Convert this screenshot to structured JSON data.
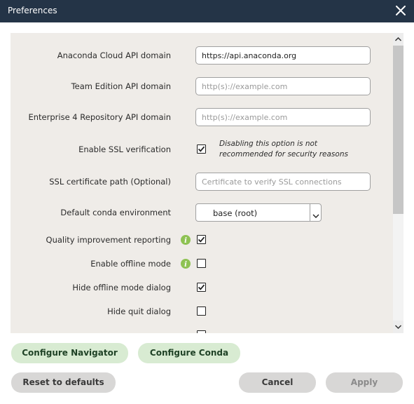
{
  "window": {
    "title": "Preferences",
    "close_icon": "close-icon"
  },
  "fields": {
    "cloud_api": {
      "label": "Anaconda Cloud API domain",
      "value": "https://api.anaconda.org",
      "placeholder": ""
    },
    "team_api": {
      "label": "Team Edition API domain",
      "value": "",
      "placeholder": "http(s)://example.com"
    },
    "enterprise_api": {
      "label": "Enterprise 4 Repository API domain",
      "value": "",
      "placeholder": "http(s)://example.com"
    },
    "ssl_verify": {
      "label": "Enable SSL verification",
      "checked": true,
      "note": "Disabling this option is not recommended for security reasons"
    },
    "ssl_cert": {
      "label": "SSL certificate path (Optional)",
      "value": "",
      "placeholder": "Certificate to verify SSL connections"
    },
    "conda_env": {
      "label": "Default conda environment",
      "value": "base (root)"
    },
    "quality": {
      "label": "Quality improvement reporting",
      "checked": true
    },
    "offline": {
      "label": "Enable offline mode",
      "checked": false
    },
    "hide_offline": {
      "label": "Hide offline mode dialog",
      "checked": true
    },
    "hide_quit": {
      "label": "Hide quit dialog",
      "checked": false
    }
  },
  "buttons": {
    "configure_navigator": "Configure Navigator",
    "configure_conda": "Configure Conda",
    "reset": "Reset to defaults",
    "cancel": "Cancel",
    "apply": "Apply"
  },
  "colors": {
    "titlebar": "#243447",
    "panel": "#efece8",
    "accent_green": "#d8ebd2",
    "info_icon": "#8ec253"
  }
}
